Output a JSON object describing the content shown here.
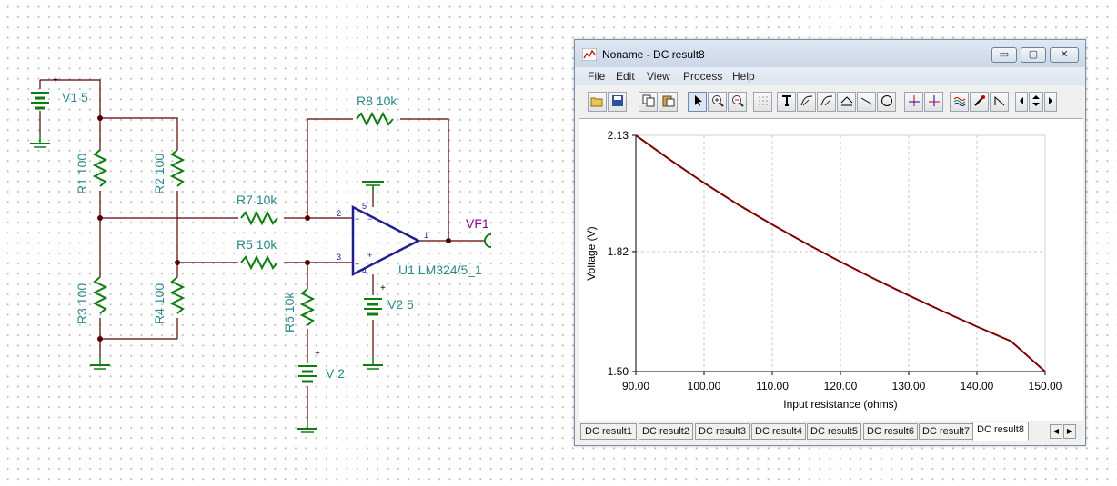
{
  "schematic": {
    "labels": {
      "v1": "V1 5",
      "r1": "R1 100",
      "r2": "R2 100",
      "r3": "R3 100",
      "r4": "R4 100",
      "r5": "R5 10k",
      "r6": "R6 10k",
      "r7": "R7 10k",
      "r8": "R8 10k",
      "u1": "U1 LM324/5_1",
      "v2": "V2 5",
      "v3": "V 2",
      "vf1": "VF1"
    },
    "pins": {
      "p2": "2",
      "p3": "3",
      "p1": "1",
      "p4": "4",
      "p5": "5",
      "minus": "−",
      "plus": "+"
    },
    "colors": {
      "wire": "#5a0000",
      "resistor": "#0f7d0f",
      "label": "#2a8a8a",
      "opamp": "#1f1f8f",
      "probe": "#8b008b"
    }
  },
  "window": {
    "title": "Noname - DC result8",
    "menu": [
      "File",
      "Edit",
      "View",
      "Process",
      "Help"
    ],
    "controls": {
      "minimize": "▭",
      "maximize": "▢",
      "close": "✕"
    },
    "toolbar": [
      "open-icon",
      "save-icon",
      "copy-icon",
      "paste-icon",
      "pointer-icon",
      "zoom-in-icon",
      "zoom-out-icon",
      "grid-icon",
      "text-icon",
      "curve-edit-icon",
      "curve-fit-icon",
      "function-icon",
      "line-icon",
      "circle-icon",
      "cursor-a-icon",
      "cursor-b-icon",
      "waves-icon",
      "probe-icon",
      "step-icon",
      "prev-icon",
      "updown-icon",
      "next-icon"
    ],
    "tabs": [
      "DC result1",
      "DC result2",
      "DC result3",
      "DC result4",
      "DC result5",
      "DC result6",
      "DC result7",
      "DC result8"
    ],
    "active_tab": "DC result8",
    "tab_nav": {
      "left": "◀",
      "right": "▶"
    }
  },
  "chart_data": {
    "type": "line",
    "title": "",
    "xlabel": "Input resistance (ohms)",
    "ylabel": "Voltage (V)",
    "xlim": [
      90,
      150
    ],
    "ylim": [
      1.5,
      2.13
    ],
    "xticks": [
      "90.00",
      "100.00",
      "110.00",
      "120.00",
      "130.00",
      "140.00",
      "150.00"
    ],
    "yticks": [
      "1.50",
      "1.82",
      "2.13"
    ],
    "grid": true,
    "series": [
      {
        "color": "#800000",
        "x": [
          90,
          95,
          100,
          105,
          110,
          115,
          120,
          125,
          130,
          135,
          140,
          145,
          150
        ],
        "y": [
          2.13,
          2.065,
          2.003,
          1.945,
          1.892,
          1.841,
          1.793,
          1.747,
          1.703,
          1.661,
          1.62,
          1.581,
          1.5
        ]
      }
    ]
  }
}
